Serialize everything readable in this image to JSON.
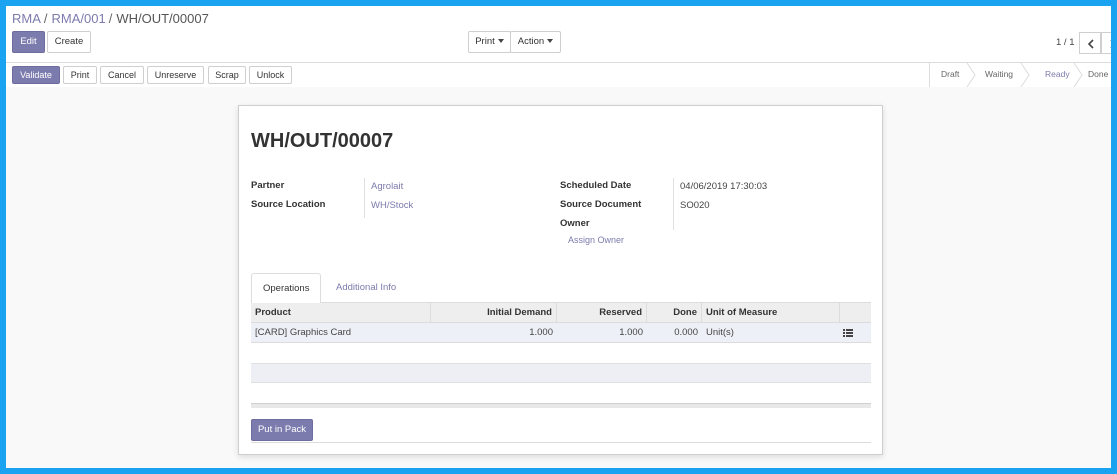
{
  "breadcrumb": {
    "items": [
      "RMA",
      "RMA/001"
    ],
    "separator": "/",
    "current": "WH/OUT/00007"
  },
  "toolbar": {
    "edit_label": "Edit",
    "create_label": "Create",
    "print_label": "Print",
    "action_label": "Action"
  },
  "pager": {
    "value": "1 / 1"
  },
  "statusbar": {
    "buttons": [
      "Validate",
      "Print",
      "Cancel",
      "Unreserve",
      "Scrap",
      "Unlock"
    ],
    "stages": [
      "Draft",
      "Waiting",
      "Ready",
      "Done"
    ],
    "active_stage": "Ready"
  },
  "record": {
    "title": "WH/OUT/00007",
    "partner_label": "Partner",
    "partner_value": "Agrolait",
    "source_location_label": "Source Location",
    "source_location_value": "WH/Stock",
    "scheduled_date_label": "Scheduled Date",
    "scheduled_date_value": "04/06/2019 17:30:03",
    "source_document_label": "Source Document",
    "source_document_value": "SO020",
    "owner_label": "Owner",
    "assign_owner_label": "Assign Owner"
  },
  "tabs": [
    "Operations",
    "Additional Info"
  ],
  "operations": {
    "headers": [
      "Product",
      "Initial Demand",
      "Reserved",
      "Done",
      "Unit of Measure"
    ],
    "rows": [
      {
        "product": "[CARD] Graphics Card",
        "initial_demand": "1.000",
        "reserved": "1.000",
        "done": "0.000",
        "uom": "Unit(s)"
      }
    ]
  },
  "put_in_pack_label": "Put in Pack",
  "colors": {
    "brand": "#7c7bad",
    "frame": "#1aa3f0"
  }
}
